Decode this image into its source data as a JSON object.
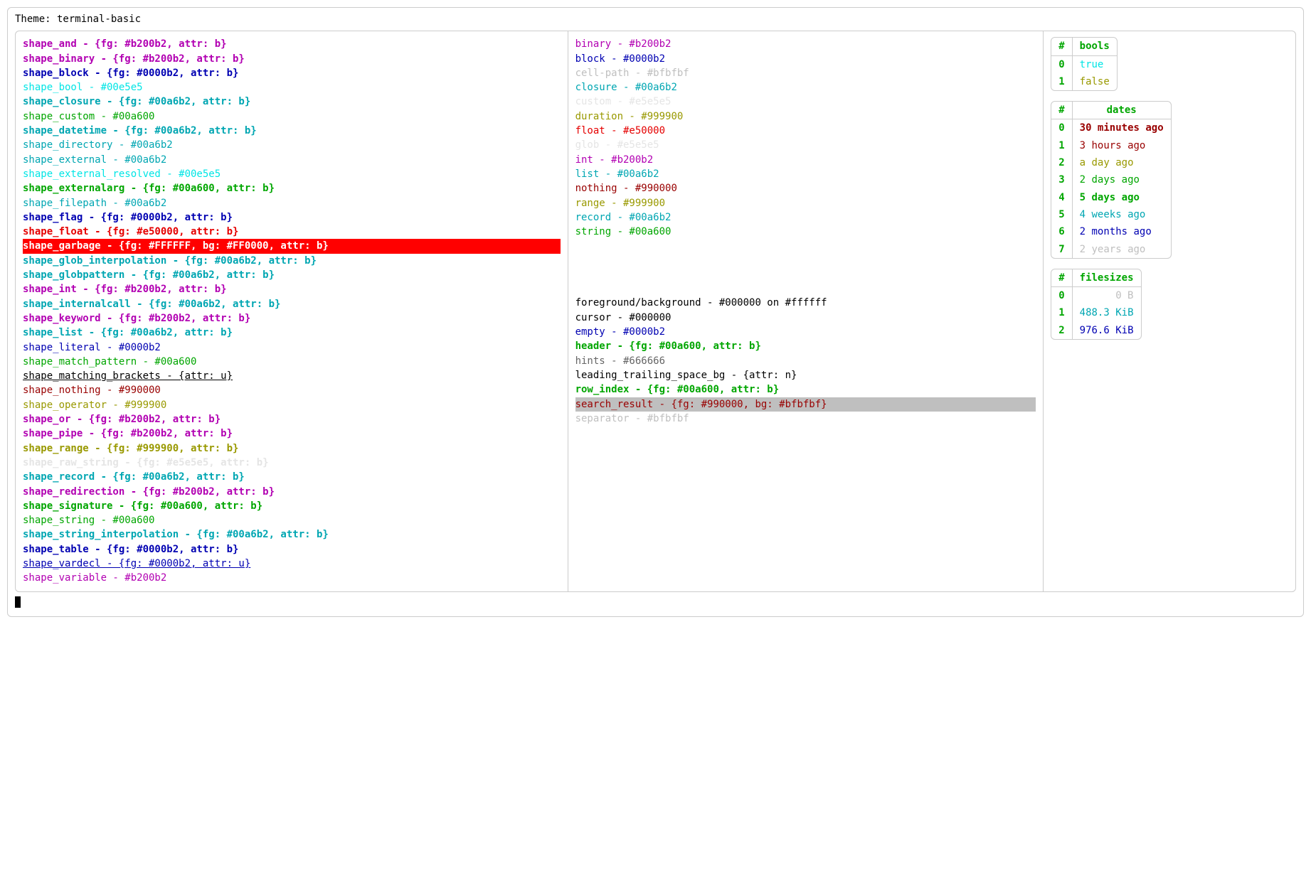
{
  "title": "Theme: terminal-basic",
  "shapes": [
    {
      "name": "shape_and",
      "value": "{fg: #b200b2, attr: b}",
      "fg": "#b200b2",
      "bold": true
    },
    {
      "name": "shape_binary",
      "value": "{fg: #b200b2, attr: b}",
      "fg": "#b200b2",
      "bold": true
    },
    {
      "name": "shape_block",
      "value": "{fg: #0000b2, attr: b}",
      "fg": "#0000b2",
      "bold": true
    },
    {
      "name": "shape_bool",
      "value": "#00e5e5",
      "fg": "#00e5e5"
    },
    {
      "name": "shape_closure",
      "value": "{fg: #00a6b2, attr: b}",
      "fg": "#00a6b2",
      "bold": true
    },
    {
      "name": "shape_custom",
      "value": "#00a600",
      "fg": "#00a600"
    },
    {
      "name": "shape_datetime",
      "value": "{fg: #00a6b2, attr: b}",
      "fg": "#00a6b2",
      "bold": true
    },
    {
      "name": "shape_directory",
      "value": "#00a6b2",
      "fg": "#00a6b2"
    },
    {
      "name": "shape_external",
      "value": "#00a6b2",
      "fg": "#00a6b2"
    },
    {
      "name": "shape_external_resolved",
      "value": "#00e5e5",
      "fg": "#00e5e5"
    },
    {
      "name": "shape_externalarg",
      "value": "{fg: #00a600, attr: b}",
      "fg": "#00a600",
      "bold": true
    },
    {
      "name": "shape_filepath",
      "value": "#00a6b2",
      "fg": "#00a6b2"
    },
    {
      "name": "shape_flag",
      "value": "{fg: #0000b2, attr: b}",
      "fg": "#0000b2",
      "bold": true
    },
    {
      "name": "shape_float",
      "value": "{fg: #e50000, attr: b}",
      "fg": "#e50000",
      "bold": true
    },
    {
      "name": "shape_garbage",
      "value": "{fg: #FFFFFF, bg: #FF0000, attr: b}",
      "fg": "#FFFFFF",
      "bg": "#FF0000",
      "bold": true
    },
    {
      "name": "shape_glob_interpolation",
      "value": "{fg: #00a6b2, attr: b}",
      "fg": "#00a6b2",
      "bold": true
    },
    {
      "name": "shape_globpattern",
      "value": "{fg: #00a6b2, attr: b}",
      "fg": "#00a6b2",
      "bold": true
    },
    {
      "name": "shape_int",
      "value": "{fg: #b200b2, attr: b}",
      "fg": "#b200b2",
      "bold": true
    },
    {
      "name": "shape_internalcall",
      "value": "{fg: #00a6b2, attr: b}",
      "fg": "#00a6b2",
      "bold": true
    },
    {
      "name": "shape_keyword",
      "value": "{fg: #b200b2, attr: b}",
      "fg": "#b200b2",
      "bold": true
    },
    {
      "name": "shape_list",
      "value": "{fg: #00a6b2, attr: b}",
      "fg": "#00a6b2",
      "bold": true
    },
    {
      "name": "shape_literal",
      "value": "#0000b2",
      "fg": "#0000b2"
    },
    {
      "name": "shape_match_pattern",
      "value": "#00a600",
      "fg": "#00a600"
    },
    {
      "name": "shape_matching_brackets",
      "value": "{attr: u}",
      "fg": "#000000",
      "underline": true
    },
    {
      "name": "shape_nothing",
      "value": "#990000",
      "fg": "#990000"
    },
    {
      "name": "shape_operator",
      "value": "#999900",
      "fg": "#999900"
    },
    {
      "name": "shape_or",
      "value": "{fg: #b200b2, attr: b}",
      "fg": "#b200b2",
      "bold": true
    },
    {
      "name": "shape_pipe",
      "value": "{fg: #b200b2, attr: b}",
      "fg": "#b200b2",
      "bold": true
    },
    {
      "name": "shape_range",
      "value": "{fg: #999900, attr: b}",
      "fg": "#999900",
      "bold": true
    },
    {
      "name": "shape_raw_string",
      "value": "{fg: #e5e5e5, attr: b}",
      "fg": "#e5e5e5",
      "bold": true
    },
    {
      "name": "shape_record",
      "value": "{fg: #00a6b2, attr: b}",
      "fg": "#00a6b2",
      "bold": true
    },
    {
      "name": "shape_redirection",
      "value": "{fg: #b200b2, attr: b}",
      "fg": "#b200b2",
      "bold": true
    },
    {
      "name": "shape_signature",
      "value": "{fg: #00a600, attr: b}",
      "fg": "#00a600",
      "bold": true
    },
    {
      "name": "shape_string",
      "value": "#00a600",
      "fg": "#00a600"
    },
    {
      "name": "shape_string_interpolation",
      "value": "{fg: #00a6b2, attr: b}",
      "fg": "#00a6b2",
      "bold": true
    },
    {
      "name": "shape_table",
      "value": "{fg: #0000b2, attr: b}",
      "fg": "#0000b2",
      "bold": true
    },
    {
      "name": "shape_vardecl",
      "value": "{fg: #0000b2, attr: u}",
      "fg": "#0000b2",
      "underline": true
    },
    {
      "name": "shape_variable",
      "value": "#b200b2",
      "fg": "#b200b2"
    }
  ],
  "types": [
    {
      "name": "binary",
      "value": "#b200b2",
      "fg": "#b200b2"
    },
    {
      "name": "block",
      "value": "#0000b2",
      "fg": "#0000b2"
    },
    {
      "name": "cell-path",
      "value": "#bfbfbf",
      "fg": "#bfbfbf"
    },
    {
      "name": "closure",
      "value": "#00a6b2",
      "fg": "#00a6b2"
    },
    {
      "name": "custom",
      "value": "#e5e5e5",
      "fg": "#e5e5e5"
    },
    {
      "name": "duration",
      "value": "#999900",
      "fg": "#999900"
    },
    {
      "name": "float",
      "value": "#e50000",
      "fg": "#e50000"
    },
    {
      "name": "glob",
      "value": "#e5e5e5",
      "fg": "#e5e5e5"
    },
    {
      "name": "int",
      "value": "#b200b2",
      "fg": "#b200b2"
    },
    {
      "name": "list",
      "value": "#00a6b2",
      "fg": "#00a6b2"
    },
    {
      "name": "nothing",
      "value": "#990000",
      "fg": "#990000"
    },
    {
      "name": "range",
      "value": "#999900",
      "fg": "#999900"
    },
    {
      "name": "record",
      "value": "#00a6b2",
      "fg": "#00a6b2"
    },
    {
      "name": "string",
      "value": "#00a600",
      "fg": "#00a600"
    }
  ],
  "misc": [
    {
      "name": "foreground/background",
      "value": "#000000 on #ffffff",
      "fg": "#000000"
    },
    {
      "name": "cursor",
      "value": "#000000",
      "fg": "#000000"
    },
    {
      "name": "empty",
      "value": "#0000b2",
      "fg": "#0000b2"
    },
    {
      "name": "header",
      "value": "{fg: #00a600, attr: b}",
      "fg": "#00a600",
      "bold": true
    },
    {
      "name": "hints",
      "value": "#666666",
      "fg": "#666666"
    },
    {
      "name": "leading_trailing_space_bg",
      "value": "{attr: n}",
      "fg": "#000000"
    },
    {
      "name": "row_index",
      "value": "{fg: #00a600, attr: b}",
      "fg": "#00a600",
      "bold": true
    },
    {
      "name": "search_result",
      "value": "{fg: #990000, bg: #bfbfbf}",
      "fg": "#990000",
      "bg": "#bfbfbf"
    },
    {
      "name": "separator",
      "value": "#bfbfbf",
      "fg": "#bfbfbf"
    }
  ],
  "tables": {
    "bools": {
      "header": [
        "#",
        "bools"
      ],
      "rows": [
        {
          "idx": "0",
          "val": "true",
          "fg": "#00e5e5"
        },
        {
          "idx": "1",
          "val": "false",
          "fg": "#999900"
        }
      ]
    },
    "dates": {
      "header": [
        "#",
        "dates"
      ],
      "rows": [
        {
          "idx": "0",
          "val": "30 minutes ago",
          "fg": "#990000",
          "bold": true
        },
        {
          "idx": "1",
          "val": "3 hours ago",
          "fg": "#990000"
        },
        {
          "idx": "2",
          "val": "a day ago",
          "fg": "#999900"
        },
        {
          "idx": "3",
          "val": "2 days ago",
          "fg": "#00a600"
        },
        {
          "idx": "4",
          "val": "5 days ago",
          "fg": "#00a600",
          "bold": true
        },
        {
          "idx": "5",
          "val": "4 weeks ago",
          "fg": "#00a6b2"
        },
        {
          "idx": "6",
          "val": "2 months ago",
          "fg": "#0000b2"
        },
        {
          "idx": "7",
          "val": "2 years ago",
          "fg": "#bfbfbf"
        }
      ]
    },
    "filesizes": {
      "header": [
        "#",
        "filesizes"
      ],
      "rows": [
        {
          "idx": "0",
          "val": "0 B",
          "fg": "#bfbfbf",
          "right": true
        },
        {
          "idx": "1",
          "val": "488.3 KiB",
          "fg": "#00a6b2",
          "right": true
        },
        {
          "idx": "2",
          "val": "976.6 KiB",
          "fg": "#0000b2",
          "right": true
        }
      ]
    }
  }
}
